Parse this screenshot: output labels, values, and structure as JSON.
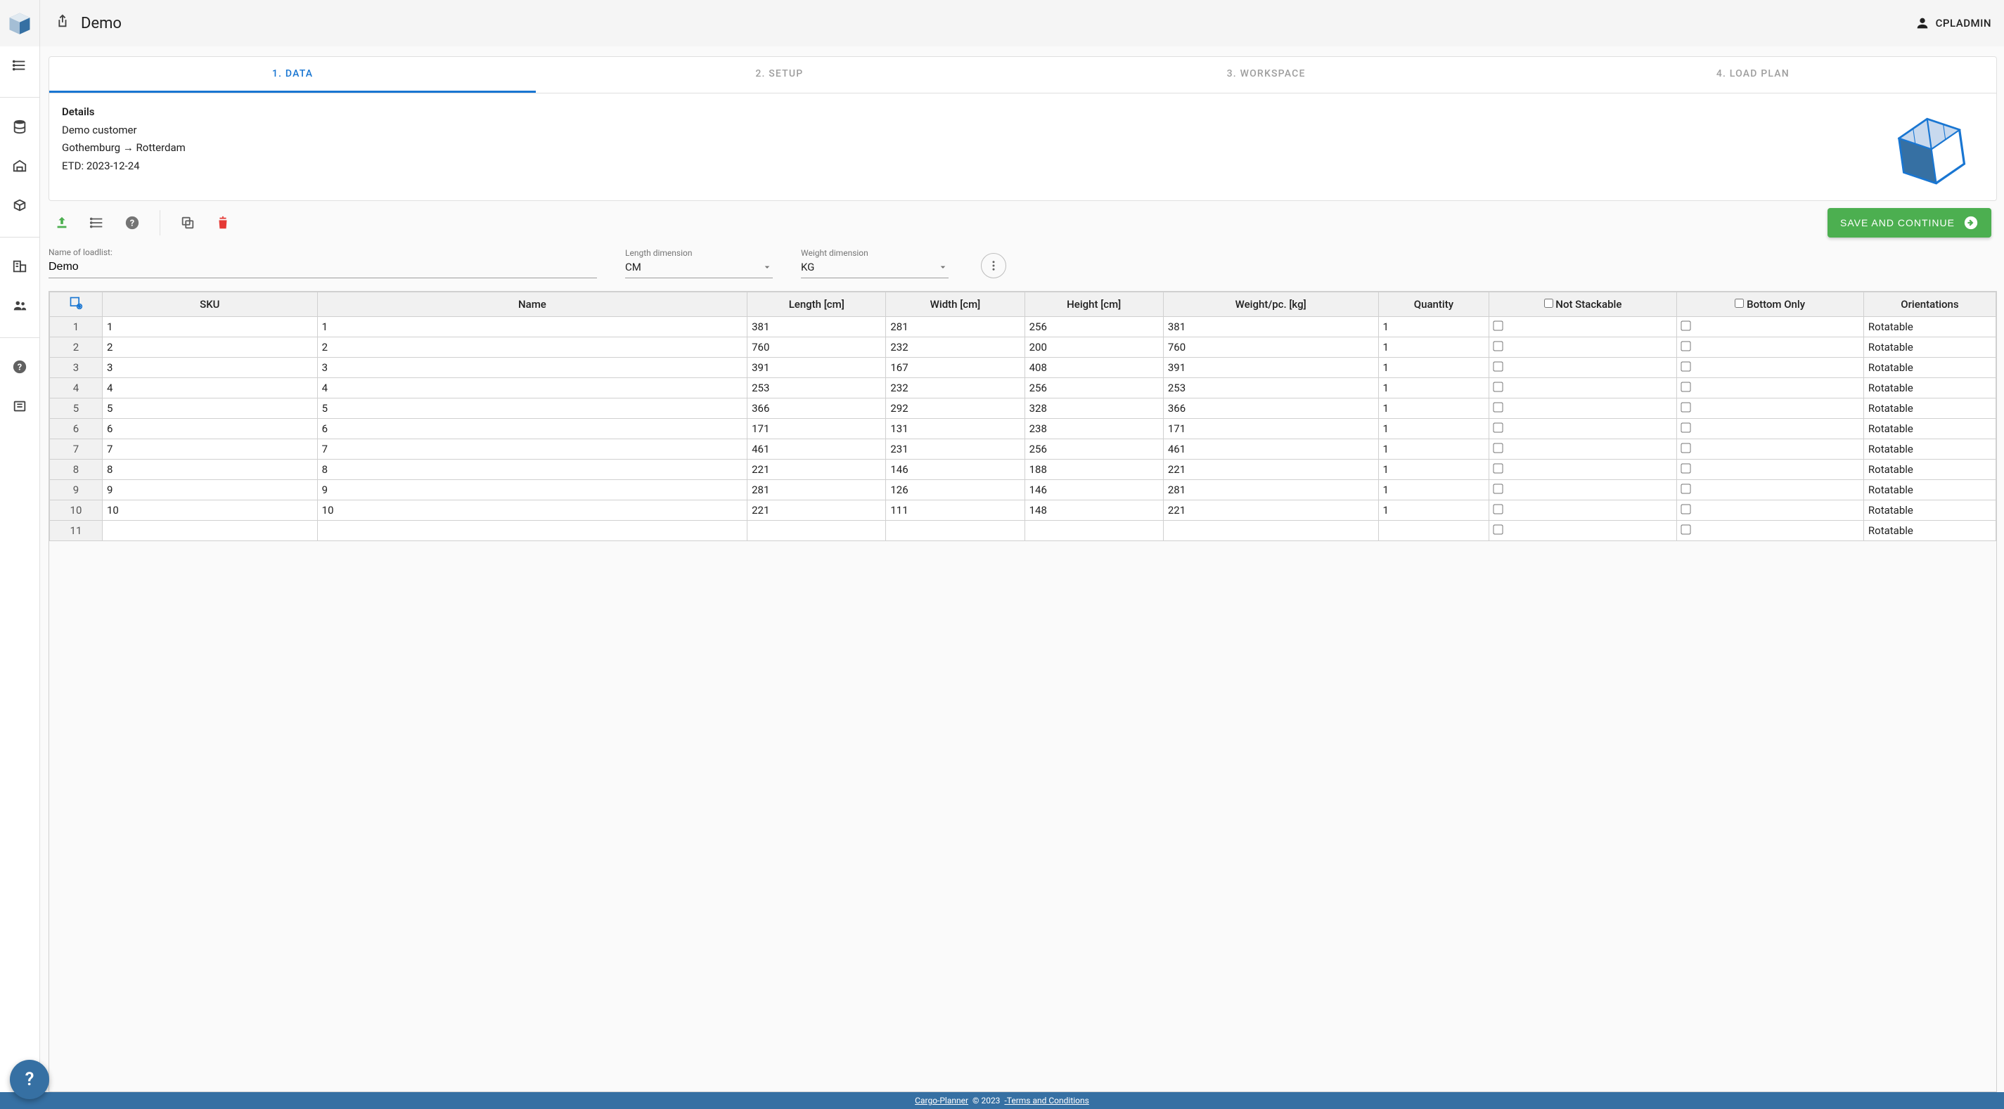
{
  "header": {
    "title": "Demo",
    "username": "CPLADMIN"
  },
  "tabs": [
    "1. DATA",
    "2. SETUP",
    "3. WORKSPACE",
    "4. LOAD PLAN"
  ],
  "details": {
    "heading": "Details",
    "customer": "Demo customer",
    "route": "Gothemburg → Rotterdam",
    "etd": "ETD: 2023-12-24"
  },
  "actions": {
    "save_label": "SAVE AND CONTINUE"
  },
  "form": {
    "name_label": "Name of loadlist:",
    "name_value": "Demo",
    "length_label": "Length dimension",
    "length_value": "CM",
    "weight_label": "Weight dimension",
    "weight_value": "KG"
  },
  "grid": {
    "headers": [
      "SKU",
      "Name",
      "Length [cm]",
      "Width [cm]",
      "Height [cm]",
      "Weight/pc. [kg]",
      "Quantity",
      "Not Stackable",
      "Bottom Only",
      "Orientations"
    ],
    "rows": [
      {
        "n": "1",
        "sku": "1",
        "name": "1",
        "l": "381",
        "w": "281",
        "h": "256",
        "wt": "381",
        "q": "1",
        "ns": false,
        "bo": false,
        "ori": "Rotatable"
      },
      {
        "n": "2",
        "sku": "2",
        "name": "2",
        "l": "760",
        "w": "232",
        "h": "200",
        "wt": "760",
        "q": "1",
        "ns": false,
        "bo": false,
        "ori": "Rotatable"
      },
      {
        "n": "3",
        "sku": "3",
        "name": "3",
        "l": "391",
        "w": "167",
        "h": "408",
        "wt": "391",
        "q": "1",
        "ns": false,
        "bo": false,
        "ori": "Rotatable"
      },
      {
        "n": "4",
        "sku": "4",
        "name": "4",
        "l": "253",
        "w": "232",
        "h": "256",
        "wt": "253",
        "q": "1",
        "ns": false,
        "bo": false,
        "ori": "Rotatable"
      },
      {
        "n": "5",
        "sku": "5",
        "name": "5",
        "l": "366",
        "w": "292",
        "h": "328",
        "wt": "366",
        "q": "1",
        "ns": false,
        "bo": false,
        "ori": "Rotatable"
      },
      {
        "n": "6",
        "sku": "6",
        "name": "6",
        "l": "171",
        "w": "131",
        "h": "238",
        "wt": "171",
        "q": "1",
        "ns": false,
        "bo": false,
        "ori": "Rotatable"
      },
      {
        "n": "7",
        "sku": "7",
        "name": "7",
        "l": "461",
        "w": "231",
        "h": "256",
        "wt": "461",
        "q": "1",
        "ns": false,
        "bo": false,
        "ori": "Rotatable"
      },
      {
        "n": "8",
        "sku": "8",
        "name": "8",
        "l": "221",
        "w": "146",
        "h": "188",
        "wt": "221",
        "q": "1",
        "ns": false,
        "bo": false,
        "ori": "Rotatable"
      },
      {
        "n": "9",
        "sku": "9",
        "name": "9",
        "l": "281",
        "w": "126",
        "h": "146",
        "wt": "281",
        "q": "1",
        "ns": false,
        "bo": false,
        "ori": "Rotatable"
      },
      {
        "n": "10",
        "sku": "10",
        "name": "10",
        "l": "221",
        "w": "111",
        "h": "148",
        "wt": "221",
        "q": "1",
        "ns": false,
        "bo": false,
        "ori": "Rotatable"
      },
      {
        "n": "11",
        "sku": "",
        "name": "",
        "l": "",
        "w": "",
        "h": "",
        "wt": "",
        "q": "",
        "ns": false,
        "bo": false,
        "ori": "Rotatable"
      }
    ]
  },
  "footer": {
    "brand": "Cargo-Planner",
    "copyright": "© 2023",
    "terms": "-Terms and Conditions"
  }
}
